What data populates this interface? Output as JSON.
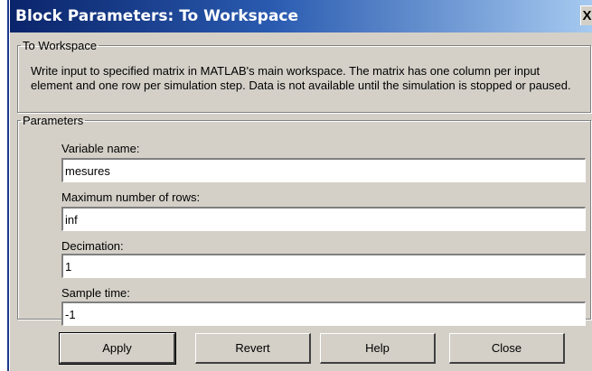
{
  "window": {
    "title": "Block Parameters: To Workspace",
    "close_glyph": "X",
    "title_color": "#0a246a"
  },
  "description": {
    "legend": "To Workspace",
    "text": "Write input to specified matrix in MATLAB's main workspace.  The matrix has one column per input element and one row per simulation step.  Data is not available until the simulation is stopped or paused."
  },
  "parameters": {
    "legend": "Parameters",
    "fields": [
      {
        "label": "Variable name:",
        "value": "mesures"
      },
      {
        "label": "Maximum number of rows:",
        "value": "inf"
      },
      {
        "label": "Decimation:",
        "value": "1"
      },
      {
        "label": "Sample time:",
        "value": "-1"
      }
    ]
  },
  "buttons": {
    "apply": "Apply",
    "revert": "Revert",
    "help": "Help",
    "close": "Close"
  },
  "icons": {
    "close": "close-icon"
  }
}
